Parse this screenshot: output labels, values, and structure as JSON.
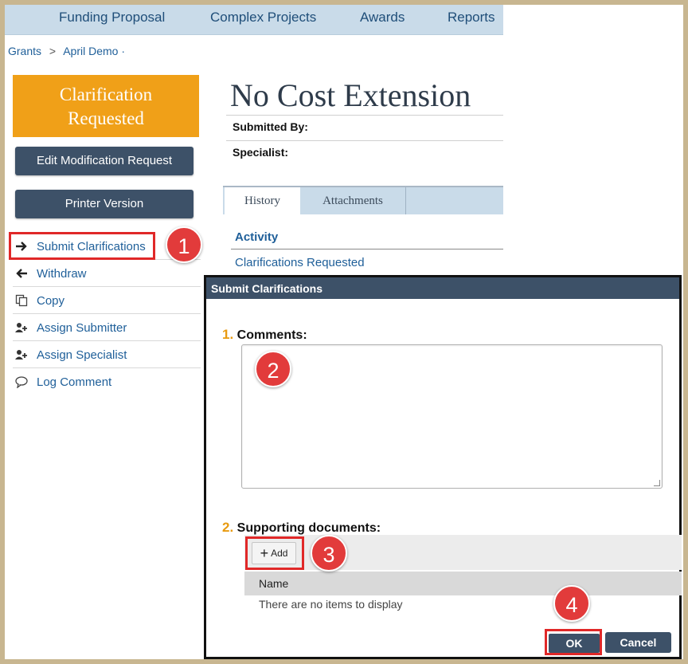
{
  "nav": {
    "items": [
      "Funding Proposal",
      "Complex Projects",
      "Awards",
      "Reports"
    ]
  },
  "breadcrumb": {
    "items": [
      "Grants",
      "April Demo"
    ],
    "separator": ">",
    "trailing": "·"
  },
  "state": {
    "label_line1": "Clarification",
    "label_line2": "Requested",
    "color": "#f0a018"
  },
  "sidebar": {
    "buttons": [
      "Edit Modification Request",
      "Printer Version"
    ],
    "actions": [
      {
        "label": "Submit Clarifications",
        "icon": "arrow-right-icon"
      },
      {
        "label": "Withdraw",
        "icon": "arrow-left-icon"
      },
      {
        "label": "Copy",
        "icon": "copy-icon"
      },
      {
        "label": "Assign Submitter",
        "icon": "assign-user-icon"
      },
      {
        "label": "Assign Specialist",
        "icon": "assign-user-icon"
      },
      {
        "label": "Log Comment",
        "icon": "comment-icon"
      }
    ]
  },
  "main": {
    "title": "No Cost Extension",
    "fields": [
      {
        "label": "Submitted By:",
        "value": ""
      },
      {
        "label": "Specialist:",
        "value": ""
      }
    ],
    "tabs": [
      {
        "label": "History",
        "active": true
      },
      {
        "label": "Attachments",
        "active": false
      }
    ],
    "activity_header": "Activity",
    "activity_items": [
      "Clarifications Requested"
    ]
  },
  "dialog": {
    "title": "Submit Clarifications",
    "section1": {
      "num": "1.",
      "label": "Comments:",
      "value": ""
    },
    "section2": {
      "num": "2.",
      "label": "Supporting documents:"
    },
    "add_label": "Add",
    "table_header": "Name",
    "empty_message": "There are no items to display",
    "ok_label": "OK",
    "cancel_label": "Cancel"
  },
  "steps": [
    "1",
    "2",
    "3",
    "4"
  ],
  "colors": {
    "accent_orange": "#f0a018",
    "nav_blue": "#c9dbe9",
    "dark_button": "#3d5168",
    "highlight_red": "#e02828",
    "badge_red": "#e23b3b"
  }
}
